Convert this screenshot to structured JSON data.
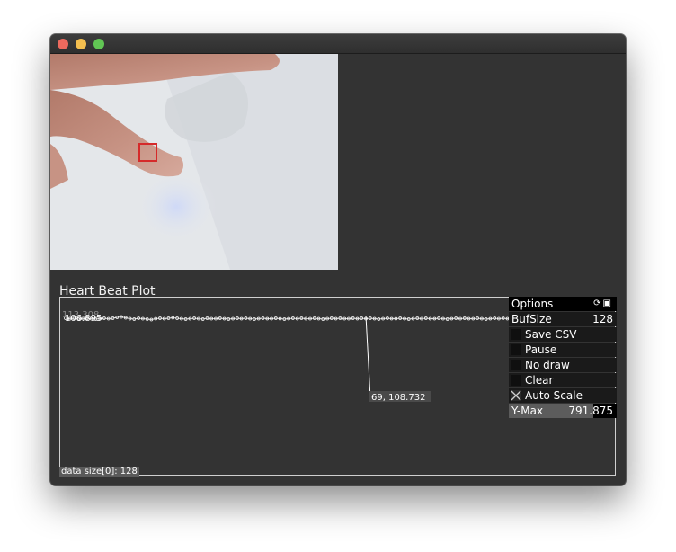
{
  "window": {
    "title": ""
  },
  "plot": {
    "title": "Heart Beat Plot",
    "labels": {
      "top_left": "106.895",
      "top_left_overlay": "113.308",
      "cursor": "69, 108.732"
    },
    "data_size": "data size[0]: 128"
  },
  "options": {
    "header": "Options",
    "icons": [
      "refresh-icon",
      "save-icon"
    ],
    "bufsize_label": "BufSize",
    "bufsize_value": "128",
    "items": [
      {
        "label": "Save CSV",
        "checked": false
      },
      {
        "label": "Pause",
        "checked": false
      },
      {
        "label": "No draw",
        "checked": false
      },
      {
        "label": "Clear",
        "checked": false
      },
      {
        "label": "Auto Scale",
        "checked": true
      }
    ],
    "ymax_label": "Y-Max",
    "ymax_value": "791.875",
    "ymax_fill": 0.78
  },
  "colors": {
    "background": "#333333",
    "roi": "#d52a2a",
    "plot_line": "#ffffff"
  },
  "chart_data": {
    "type": "line",
    "buffer_size": 128,
    "cursor_point": {
      "x": 69,
      "y": 108.732
    },
    "series": [
      {
        "values": [
          106.9,
          106.8,
          106.9,
          106.7,
          106.8,
          106.9,
          106.8,
          106.7,
          106.8,
          106.9,
          106.8,
          106.9,
          107.1,
          107.2,
          107.0,
          106.8,
          106.7,
          106.9,
          106.8,
          106.7,
          106.6,
          106.8,
          106.9,
          106.8,
          106.9,
          107.0,
          106.9,
          106.8,
          106.7,
          106.8,
          106.9,
          106.8,
          106.7,
          106.9,
          106.8,
          106.8,
          106.9,
          106.8,
          106.7,
          106.8,
          106.9,
          106.8,
          106.9,
          106.8,
          106.7,
          106.8,
          106.9,
          106.8,
          106.8,
          106.9,
          106.8,
          106.7,
          106.8,
          106.9,
          106.8,
          106.9,
          106.8,
          106.8,
          106.9,
          106.8,
          106.7,
          106.8,
          106.9,
          106.8,
          106.9,
          106.8,
          106.8,
          106.9,
          106.8,
          108.732,
          106.8,
          106.9,
          106.8,
          106.7,
          106.8,
          106.9,
          106.8,
          106.8,
          106.9,
          106.8,
          106.7,
          106.8,
          106.9,
          106.8,
          106.9,
          106.8,
          106.8,
          106.9,
          106.8,
          106.7,
          106.8,
          106.9,
          106.8,
          106.9,
          106.8,
          106.8,
          106.9,
          106.8,
          106.7,
          106.8,
          106.9,
          106.8,
          106.9,
          106.8,
          106.8,
          106.9,
          106.8,
          106.7,
          106.8,
          106.9,
          106.8,
          106.9,
          106.8,
          106.8,
          106.9,
          106.8,
          106.7,
          106.8,
          106.9,
          106.8,
          106.9,
          106.8,
          106.8,
          106.9,
          106.8,
          106.7,
          106.8,
          106.9
        ]
      }
    ]
  }
}
